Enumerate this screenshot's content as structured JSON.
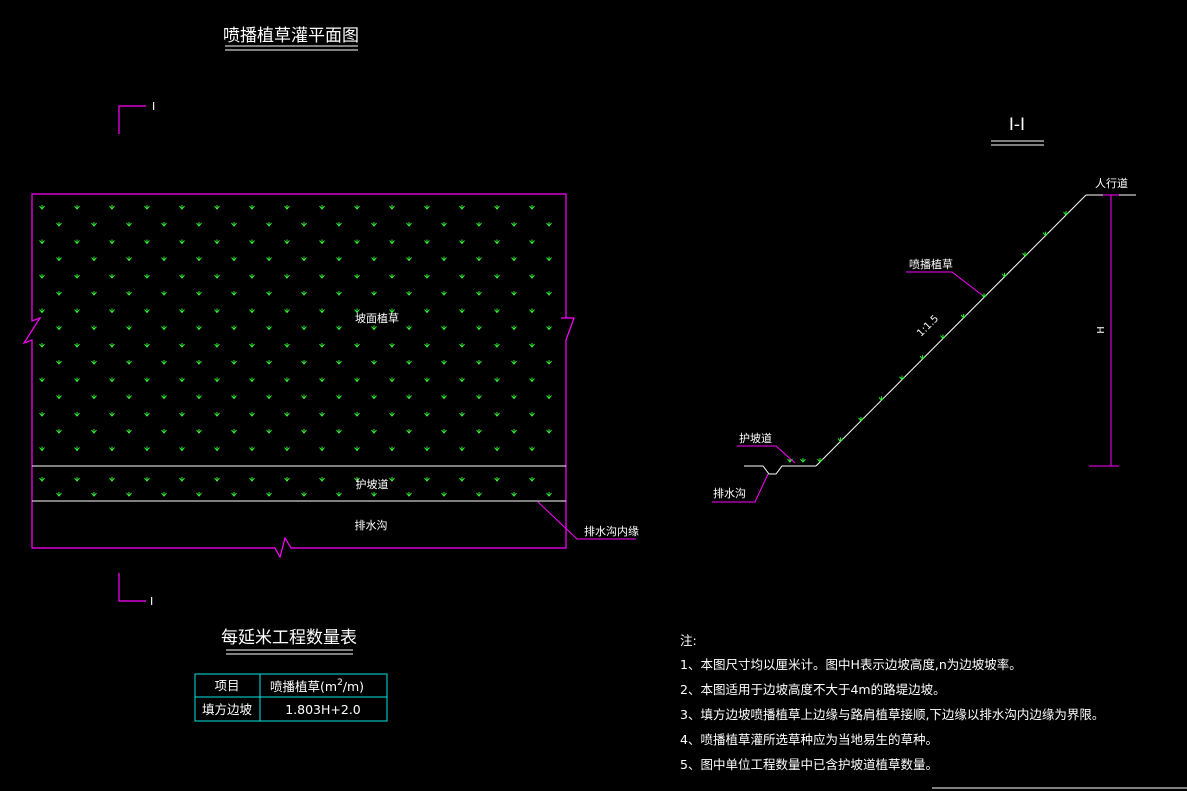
{
  "plan": {
    "title": "喷播植草灌平面图",
    "section_mark": "I",
    "area_label": "坡面植草",
    "berm_label": "护坡道",
    "ditch_label": "排水沟",
    "ditch_edge_label": "排水沟内缘"
  },
  "section": {
    "title": "I-I",
    "sidewalk_label": "人行道",
    "grass_label": "喷播植草",
    "slope_ratio": "1:1.5",
    "height_label": "H",
    "berm_label": "护坡道",
    "ditch_label": "排水沟"
  },
  "table": {
    "title": "每延米工程数量表",
    "header_item": "项目",
    "header_qty_prefix": "喷播植草(m",
    "header_qty_sup": "2",
    "header_qty_suffix": "/m)",
    "row_item": "填方边坡",
    "row_qty": "1.803H+2.0"
  },
  "notes": {
    "title": "注:",
    "items": [
      "1、本图尺寸均以厘米计。图中H表示边坡高度,n为边坡坡率。",
      "2、本图适用于边坡高度不大于4m的路堤边坡。",
      "3、填方边坡喷播植草上边缘与路肩植草接顺,下边缘以排水沟内边缘为界限。",
      "4、喷播植草灌所选草种应为当地易生的草种。",
      "5、图中单位工程数量中已含护坡道植草数量。"
    ]
  },
  "colors": {
    "background": "#000000",
    "outline": "#ff00ff",
    "grass": "#33ff33",
    "text": "#ffffff",
    "table": "#00e5e5",
    "line": "#ffffff"
  }
}
